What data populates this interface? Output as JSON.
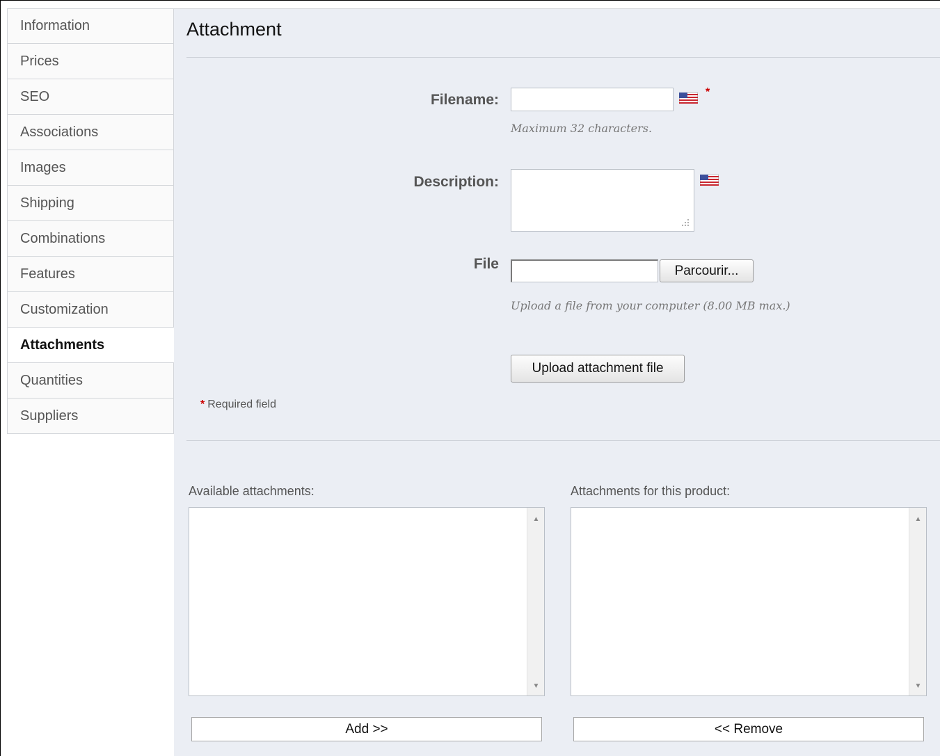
{
  "sidebar": {
    "items": [
      {
        "label": "Information",
        "active": false
      },
      {
        "label": "Prices",
        "active": false
      },
      {
        "label": "SEO",
        "active": false
      },
      {
        "label": "Associations",
        "active": false
      },
      {
        "label": "Images",
        "active": false
      },
      {
        "label": "Shipping",
        "active": false
      },
      {
        "label": "Combinations",
        "active": false
      },
      {
        "label": "Features",
        "active": false
      },
      {
        "label": "Customization",
        "active": false
      },
      {
        "label": "Attachments",
        "active": true
      },
      {
        "label": "Quantities",
        "active": false
      },
      {
        "label": "Suppliers",
        "active": false
      }
    ]
  },
  "main": {
    "title": "Attachment",
    "form": {
      "filename_label": "Filename:",
      "filename_value": "",
      "filename_hint": "Maximum 32 characters.",
      "required_marker": "*",
      "description_label": "Description:",
      "description_value": "",
      "file_label": "File",
      "file_value": "",
      "browse_button": "Parcourir...",
      "file_hint": "Upload a file from your computer (8.00 MB max.)",
      "upload_button": "Upload attachment file",
      "required_note": "Required field"
    },
    "lists": {
      "available_label": "Available attachments:",
      "available_items": [],
      "product_label": "Attachments for this product:",
      "product_items": [],
      "add_button": "Add >>",
      "remove_button": "<< Remove"
    }
  },
  "icons": {
    "flag": "us-flag-icon",
    "scroll_up": "scroll-up-arrow-icon",
    "scroll_down": "scroll-down-arrow-icon"
  },
  "colors": {
    "panel_bg": "#ebeef4",
    "required_red": "#cc0000"
  }
}
